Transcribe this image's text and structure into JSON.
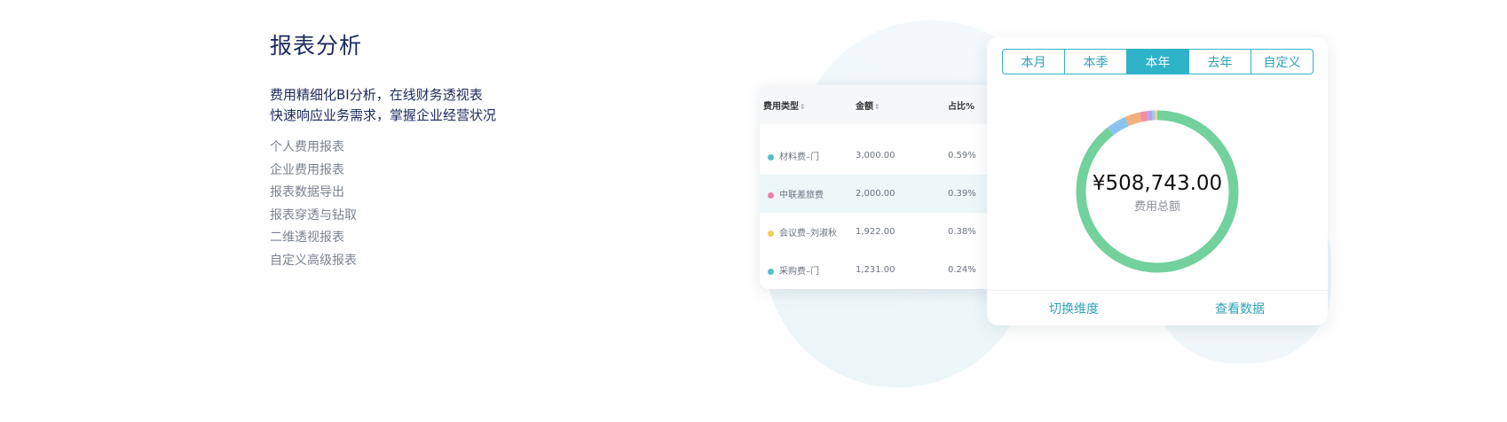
{
  "section": {
    "title": "报表分析",
    "subtitle_line1": "费用精细化BI分析，在线财务透视表",
    "subtitle_line2": "快速响应业务需求，掌握企业经营状况",
    "features": [
      "个人费用报表",
      "企业费用报表",
      "报表数据导出",
      "报表穿透与钻取",
      "二维透视报表",
      "自定义高级报表"
    ]
  },
  "table": {
    "headers": {
      "type": "费用类型",
      "amount": "金额",
      "ratio": "占比%"
    },
    "sort_glyph": "⇕",
    "rows": [
      {
        "name": "材料费–门",
        "amount": "3,000.00",
        "ratio": "0.59%",
        "color": "#4fc0c8"
      },
      {
        "name": "中联差旅费",
        "amount": "2,000.00",
        "ratio": "0.39%",
        "color": "#f07fa6"
      },
      {
        "name": "会议费–刘淑秋",
        "amount": "1,922.00",
        "ratio": "0.38%",
        "color": "#f5cd5a"
      },
      {
        "name": "采购费–门",
        "amount": "1,231.00",
        "ratio": "0.24%",
        "color": "#4fc0c8"
      }
    ]
  },
  "donut_card": {
    "tabs": [
      "本月",
      "本季",
      "本年",
      "去年",
      "自定义"
    ],
    "active_tab": "本年",
    "total": "¥508,743.00",
    "total_label": "费用总额",
    "actions": {
      "switch": "切换维度",
      "view": "查看数据"
    },
    "segments": [
      {
        "fraction": 0.895,
        "color": "#72d19c"
      },
      {
        "fraction": 0.04,
        "color": "#8cc3ee"
      },
      {
        "fraction": 0.03,
        "color": "#f3b07c"
      },
      {
        "fraction": 0.015,
        "color": "#f08fa4"
      },
      {
        "fraction": 0.01,
        "color": "#b7a2e8"
      },
      {
        "fraction": 0.006,
        "color": "#9ad0e8"
      },
      {
        "fraction": 0.004,
        "color": "#e8d98a"
      }
    ]
  }
}
